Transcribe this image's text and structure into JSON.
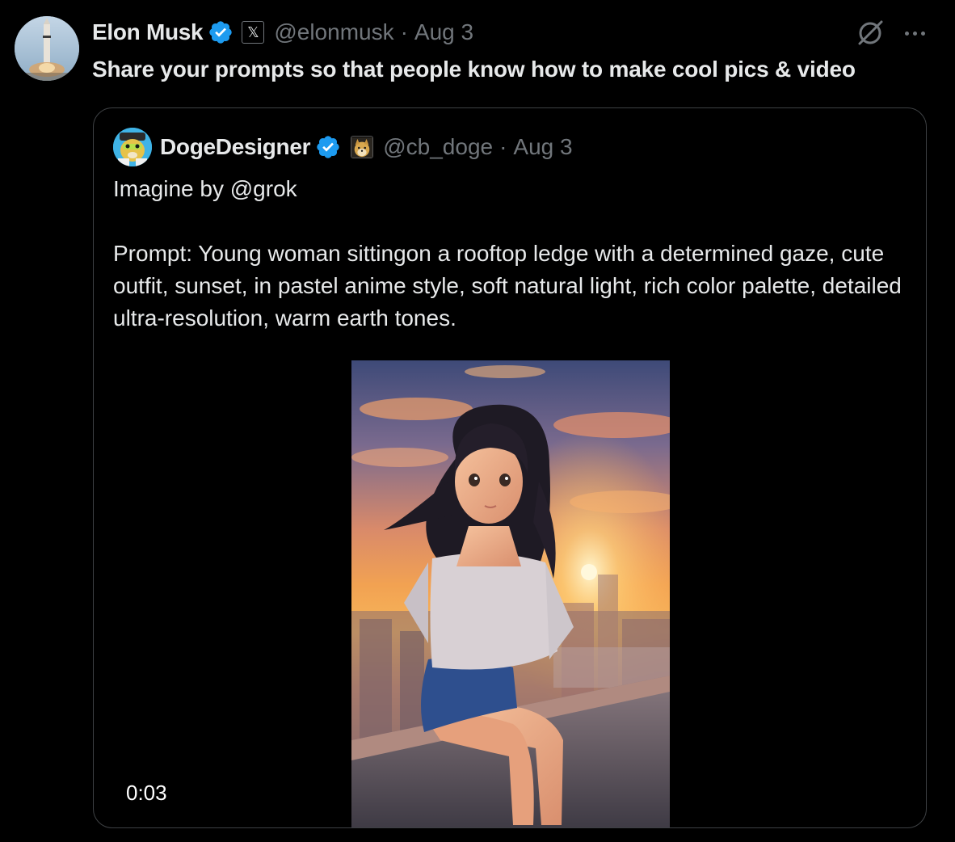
{
  "post": {
    "author": {
      "name": "Elon Musk",
      "handle": "@elonmusk",
      "affiliate_icon": "x-logo",
      "verified_icon": "verified-badge-icon"
    },
    "separator": "·",
    "date": "Aug 3",
    "text": "Share your prompts so that people know how to make cool pics & video",
    "actions": {
      "grok_icon": "grok-icon",
      "more_icon": "more-options-icon"
    }
  },
  "quote": {
    "author": {
      "name": "DogeDesigner",
      "handle": "@cb_doge",
      "affiliate_icon": "doge-icon",
      "verified_icon": "verified-badge-icon"
    },
    "separator": "·",
    "date": "Aug 3",
    "text_line1": "Imagine by @grok",
    "text_line2": "Prompt: Young woman sittingon a rooftop ledge with a determined gaze, cute outfit, sunset, in pastel anime style, soft natural light, rich color palette, detailed ultra-resolution, warm earth tones.",
    "media": {
      "type": "video",
      "duration": "0:03"
    }
  },
  "colors": {
    "background": "#000000",
    "text_primary": "#e7e9ea",
    "text_secondary": "#71767b",
    "verified_blue": "#1d9bf0",
    "card_border": "#3e4144"
  }
}
